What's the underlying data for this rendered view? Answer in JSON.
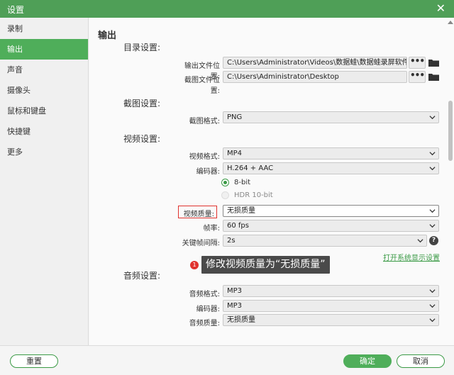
{
  "window": {
    "title": "设置",
    "close_glyph": "✕"
  },
  "sidebar": {
    "items": [
      {
        "label": "录制"
      },
      {
        "label": "输出"
      },
      {
        "label": "声音"
      },
      {
        "label": "摄像头"
      },
      {
        "label": "鼠标和键盘"
      },
      {
        "label": "快捷键"
      },
      {
        "label": "更多"
      }
    ],
    "active_index": 1
  },
  "main": {
    "section_title": "输出",
    "directory": {
      "title": "目录设置:",
      "output_label": "输出文件位置:",
      "output_value": "C:\\Users\\Administrator\\Videos\\数据蛙\\数据蛙录屏软件",
      "screenshot_label": "截图文件位置:",
      "screenshot_value": "C:\\Users\\Administrator\\Desktop",
      "browse_glyph": "•••"
    },
    "screenshot": {
      "title": "截图设置:",
      "format_label": "截图格式:",
      "format_value": "PNG"
    },
    "video": {
      "title": "视频设置:",
      "format_label": "视频格式:",
      "format_value": "MP4",
      "encoder_label": "编码器:",
      "encoder_value": "H.264 + AAC",
      "bit_options": [
        "8-bit",
        "HDR 10-bit"
      ],
      "quality_label": "视频质量:",
      "quality_value": "无损质量",
      "fps_label": "帧率:",
      "fps_value": "60 fps",
      "keyframe_label": "关键帧间隔:",
      "keyframe_value": "2s",
      "help_glyph": "?",
      "display_link": "打开系统显示设置"
    },
    "audio": {
      "title": "音频设置:",
      "format_label": "音频格式:",
      "format_value": "MP3",
      "encoder_label": "编码器:",
      "encoder_value": "MP3",
      "quality_label": "音频质量:",
      "quality_value": "无损质量"
    }
  },
  "annotation": {
    "badge": "1",
    "text": "修改视频质量为“无损质量”"
  },
  "footer": {
    "reset_label": "重置",
    "ok_label": "确定",
    "cancel_label": "取消"
  },
  "colors": {
    "accent": "#4fae5a",
    "titlebar": "#4f9f57",
    "highlight": "#e0322e"
  }
}
